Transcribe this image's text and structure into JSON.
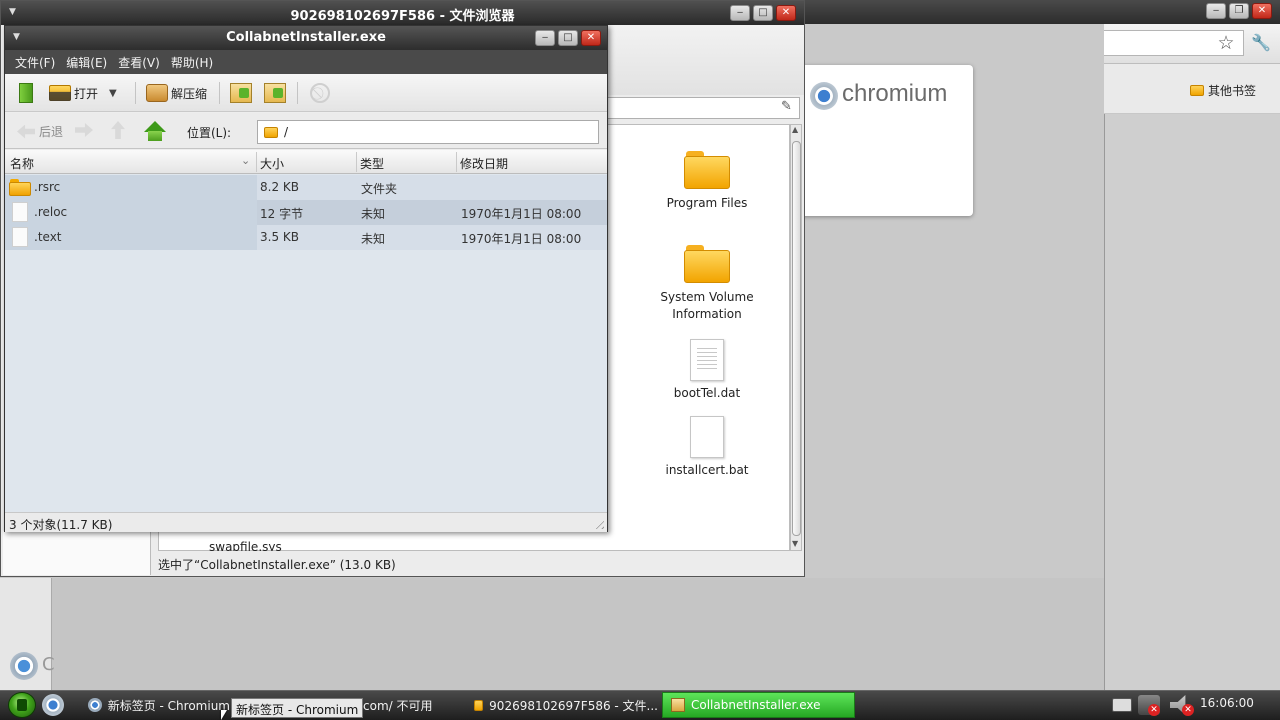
{
  "file_browser": {
    "title": "902698102697F586 - 文件浏览器",
    "desktop_items": [
      {
        "label": "Program Files",
        "icon": "folder-icon"
      },
      {
        "label": "System Volume Information",
        "icon": "folder-icon"
      },
      {
        "label": "bootTel.dat",
        "icon": "file-icon"
      },
      {
        "label": "installcert.bat",
        "icon": "file-icon"
      }
    ],
    "partial_item": "swapfile.sys",
    "status": "选中了“CollabnetInstaller.exe” (13.0 KB)"
  },
  "chromium": {
    "brand": "chromium",
    "left_letter": "C",
    "other_bookmarks": "其他书签"
  },
  "archive_window": {
    "title": "CollabnetInstaller.exe",
    "menu": [
      "文件(F)",
      "编辑(E)",
      "查看(V)",
      "帮助(H)"
    ],
    "toolbar": {
      "open": "打开",
      "extract": "解压缩"
    },
    "nav": {
      "back": "后退",
      "location_label": "位置(L):",
      "location_value": "/"
    },
    "columns": [
      "名称",
      "大小",
      "类型",
      "修改日期"
    ],
    "rows": [
      {
        "name": ".rsrc",
        "size": "8.2 KB",
        "type": "文件夹",
        "modified": "",
        "kind": "folder"
      },
      {
        "name": ".reloc",
        "size": "12 字节",
        "type": "未知",
        "modified": "1970年1月1日 08:00",
        "kind": "file"
      },
      {
        "name": ".text",
        "size": "3.5 KB",
        "type": "未知",
        "modified": "1970年1月1日 08:00",
        "kind": "file"
      }
    ],
    "status": "3 个对象(11.7 KB)"
  },
  "taskbar": {
    "tasks": [
      {
        "label": "新标签页 - Chromium"
      },
      {
        "label": "com/ 不可用"
      },
      {
        "label": "902698102697F586 - 文件..."
      },
      {
        "label": "CollabnetInstaller.exe"
      }
    ],
    "tooltip": "新标签页 - Chromium",
    "clock": "16:06:00"
  },
  "colors": {
    "active_task": "#3cc43a",
    "title_bar": "#2d2d2d",
    "list_bg": "#dfe6ed",
    "folder": "#f2a400"
  }
}
